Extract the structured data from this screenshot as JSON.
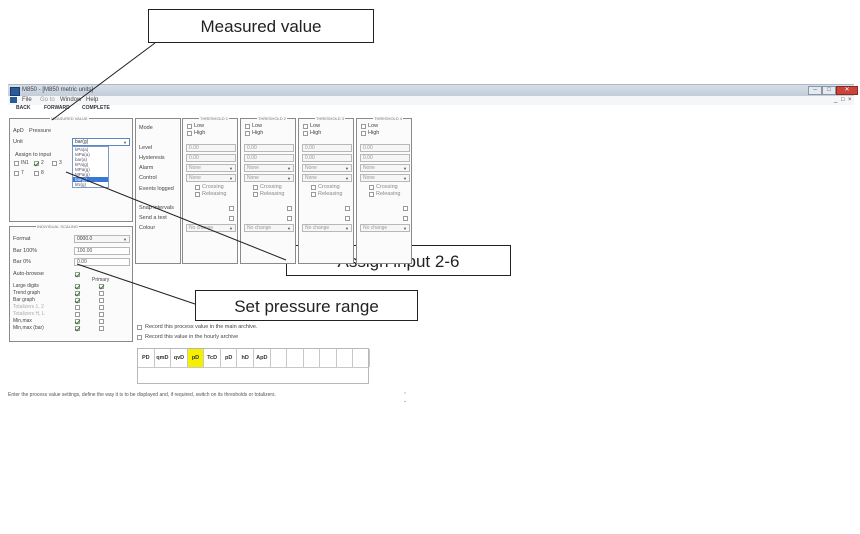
{
  "callouts": {
    "measured_value": "Measured value",
    "assign_input": "Assign input 2-6",
    "set_pressure": "Set pressure range"
  },
  "window": {
    "title": "M850 - [M850 metric units]",
    "minimize": "–",
    "maximize": "□",
    "close": "✕"
  },
  "menu": {
    "file": "File",
    "goto": "Go to",
    "window": "Window",
    "help": "Help",
    "mdi_buttons": [
      "_",
      "□",
      "×"
    ]
  },
  "nav": {
    "back": "BACK",
    "forward": "FORWARD",
    "complete": "COMPLETE"
  },
  "measure_panel": {
    "legend": "MEASURED VALUE",
    "symbol": "ApD",
    "name": "Pressure",
    "unit_label": "Unit",
    "unit_value": "bar(g)",
    "assign_label": "Assign to input",
    "inputs": [
      "IN1",
      "2",
      "3",
      "7",
      "8"
    ],
    "unit_options": [
      "kPa(a)",
      "MPa(a)",
      "bar(a)",
      "kPa(g)",
      "MPa(g)",
      "MPa(g)",
      "bar(g)",
      "kN(g)"
    ],
    "unit_options_selected_index": 6
  },
  "scaling_panel": {
    "legend": "INDIVIDUAL SCALING",
    "format_label": "Format",
    "format_value": "0000.0",
    "bar100_label": "Bar 100%",
    "bar100_value": "100.00",
    "bar0_label": "Bar 0%",
    "bar0_value": "0.00",
    "autobrowse_label": "Auto-browse",
    "primary_label": "Primary",
    "rows": [
      {
        "label": "Large digits",
        "c1": true,
        "c2": true
      },
      {
        "label": "Trend graph",
        "c1": true,
        "c2": false
      },
      {
        "label": "Bar graph",
        "c1": true,
        "c2": false
      },
      {
        "label": "Totalizers 1, 2",
        "c1": false,
        "c2": false
      },
      {
        "label": "Totalizers H, L",
        "c1": false,
        "c2": false
      },
      {
        "label": "Min,max",
        "c1": true,
        "c2": false
      },
      {
        "label": "Min,max (bar)",
        "c1": true,
        "c2": false
      }
    ]
  },
  "thresholds": {
    "row_labels": [
      "Mode",
      "Level",
      "Hysteresis",
      "Alarm",
      "Control",
      "Events logged",
      "Snap intervals",
      "Send a text",
      "Colour"
    ],
    "columns": [
      {
        "legend": "THRESHOLD 1",
        "low": "Low",
        "high": "High",
        "level": "0.00",
        "hysteresis": "0.00",
        "alarm": "None",
        "control": "None",
        "crossing": "Crossing",
        "releasing": "Releasing",
        "colour": "No change"
      },
      {
        "legend": "THRESHOLD 2",
        "low": "Low",
        "high": "High",
        "level": "0.00",
        "hysteresis": "0.00",
        "alarm": "None",
        "control": "None",
        "crossing": "Crossing",
        "releasing": "Releasing",
        "colour": "No change"
      },
      {
        "legend": "THRESHOLD 3",
        "low": "Low",
        "high": "High",
        "level": "0.00",
        "hysteresis": "0.00",
        "alarm": "None",
        "control": "None",
        "crossing": "Crossing",
        "releasing": "Releasing",
        "colour": "No change"
      },
      {
        "legend": "THRESHOLD 4",
        "low": "Low",
        "high": "High",
        "level": "0.00",
        "hysteresis": "0.00",
        "alarm": "None",
        "control": "None",
        "crossing": "Crossing",
        "releasing": "Releasing",
        "colour": "No change"
      }
    ]
  },
  "archive": {
    "main": "Record this process value in the main archive.",
    "hourly": "Record this value in the hourly archive"
  },
  "value_tabs": {
    "items": [
      "PD",
      "qmD",
      "qvD",
      "pD",
      "TcD",
      "pD",
      "hD",
      "ApD",
      "",
      "",
      "",
      "",
      "",
      ""
    ],
    "highlighted_index": 3,
    "highlight_color": "#f4f000"
  },
  "status": {
    "text": "Enter the process value settings, define the way it is to be displayed and, if required, switch on its thresholds or totalizers."
  }
}
